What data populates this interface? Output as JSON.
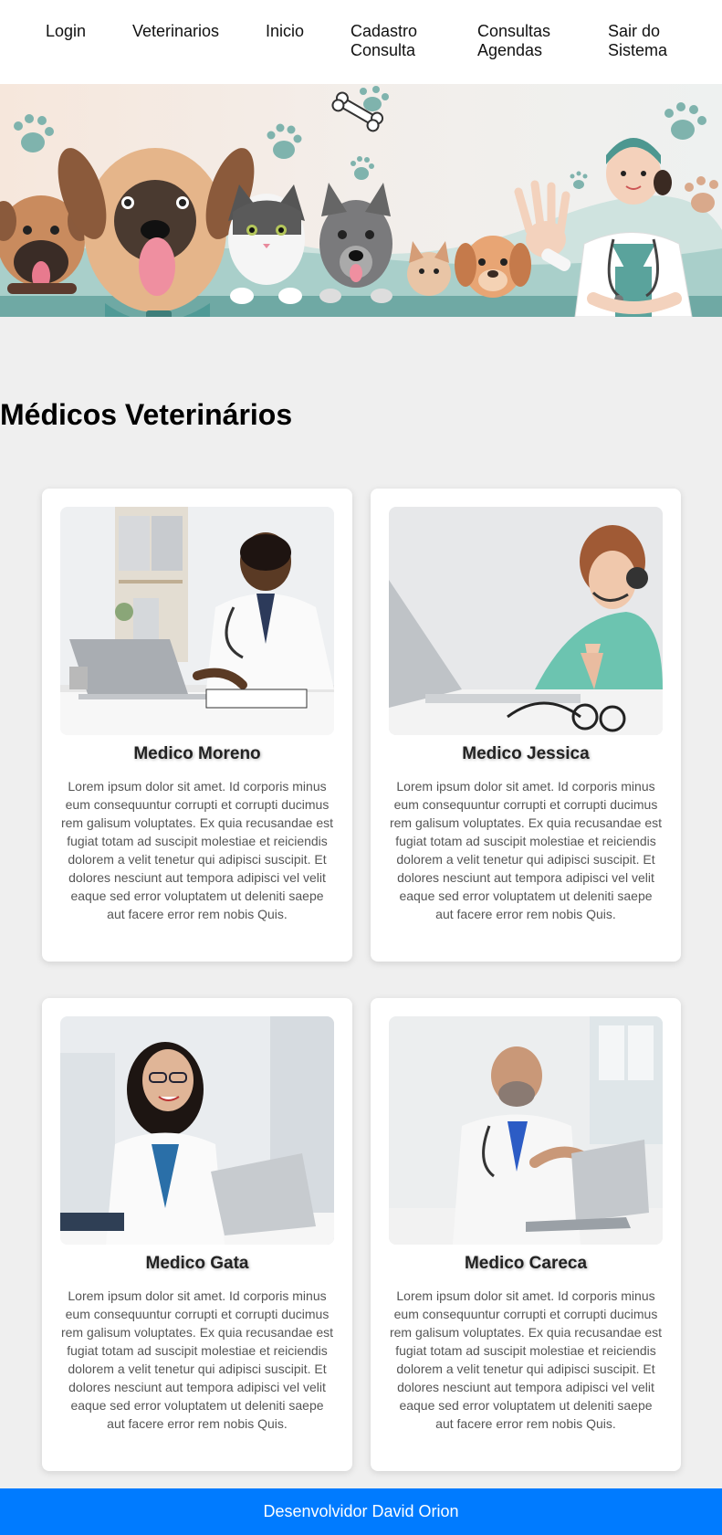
{
  "nav": {
    "items": [
      {
        "label": "Login"
      },
      {
        "label": "Veterinarios"
      },
      {
        "label": "Inicio"
      },
      {
        "label": "Cadastro Consulta"
      },
      {
        "label": "Consultas Agendas"
      },
      {
        "label": "Sair do Sistema"
      }
    ]
  },
  "page": {
    "section_title": "Médicos Veterinários"
  },
  "cards": [
    {
      "name": "Medico Moreno",
      "text": "Lorem ipsum dolor sit amet. Id corporis minus eum consequuntur corrupti et corrupti ducimus rem galisum voluptates. Ex quia recusandae est fugiat totam ad suscipit molestiae et reiciendis dolorem a velit tenetur qui adipisci suscipit. Et dolores nesciunt aut tempora adipisci vel velit eaque sed error voluptatem ut deleniti saepe aut facere error rem nobis Quis."
    },
    {
      "name": "Medico Jessica",
      "text": "Lorem ipsum dolor sit amet. Id corporis minus eum consequuntur corrupti et corrupti ducimus rem galisum voluptates. Ex quia recusandae est fugiat totam ad suscipit molestiae et reiciendis dolorem a velit tenetur qui adipisci suscipit. Et dolores nesciunt aut tempora adipisci vel velit eaque sed error voluptatem ut deleniti saepe aut facere error rem nobis Quis."
    },
    {
      "name": "Medico Gata",
      "text": "Lorem ipsum dolor sit amet. Id corporis minus eum consequuntur corrupti et corrupti ducimus rem galisum voluptates. Ex quia recusandae est fugiat totam ad suscipit molestiae et reiciendis dolorem a velit tenetur qui adipisci suscipit. Et dolores nesciunt aut tempora adipisci vel velit eaque sed error voluptatem ut deleniti saepe aut facere error rem nobis Quis."
    },
    {
      "name": "Medico Careca",
      "text": "Lorem ipsum dolor sit amet. Id corporis minus eum consequuntur corrupti et corrupti ducimus rem galisum voluptates. Ex quia recusandae est fugiat totam ad suscipit molestiae et reiciendis dolorem a velit tenetur qui adipisci suscipit. Et dolores nesciunt aut tempora adipisci vel velit eaque sed error voluptatem ut deleniti saepe aut facere error rem nobis Quis."
    }
  ],
  "footer": {
    "text": "Desenvolvidor David Orion"
  },
  "colors": {
    "footer_bg": "#007bff",
    "page_bg": "#efefef",
    "banner_teal": "#6fa9a4"
  }
}
